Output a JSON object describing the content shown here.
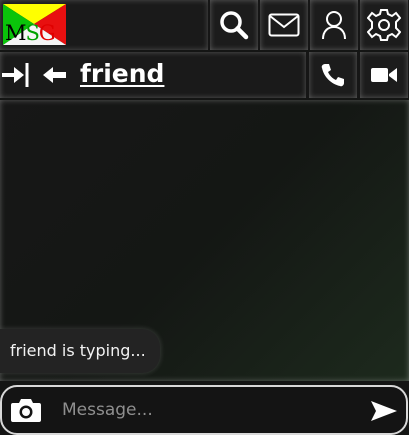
{
  "app": {
    "logo_text": "MSG",
    "logo_colors": {
      "triangle_left": "#0ac40a",
      "triangle_top": "#ffff00",
      "triangle_right": "#e81010"
    }
  },
  "header": {
    "icons": [
      "search-icon",
      "mail-icon",
      "user-icon",
      "settings-icon"
    ]
  },
  "conversation": {
    "title": "friend",
    "icons": [
      "sidebar-toggle-icon",
      "back-arrow-icon",
      "phone-icon",
      "video-icon"
    ]
  },
  "chat": {
    "typing_indicator": "friend is typing..."
  },
  "composer": {
    "placeholder": "Message...",
    "value": "",
    "icons": [
      "camera-icon",
      "send-icon"
    ]
  },
  "colors": {
    "background": "#141514",
    "panel": "#1c1c1c",
    "composer_border": "#d8d8d8"
  }
}
